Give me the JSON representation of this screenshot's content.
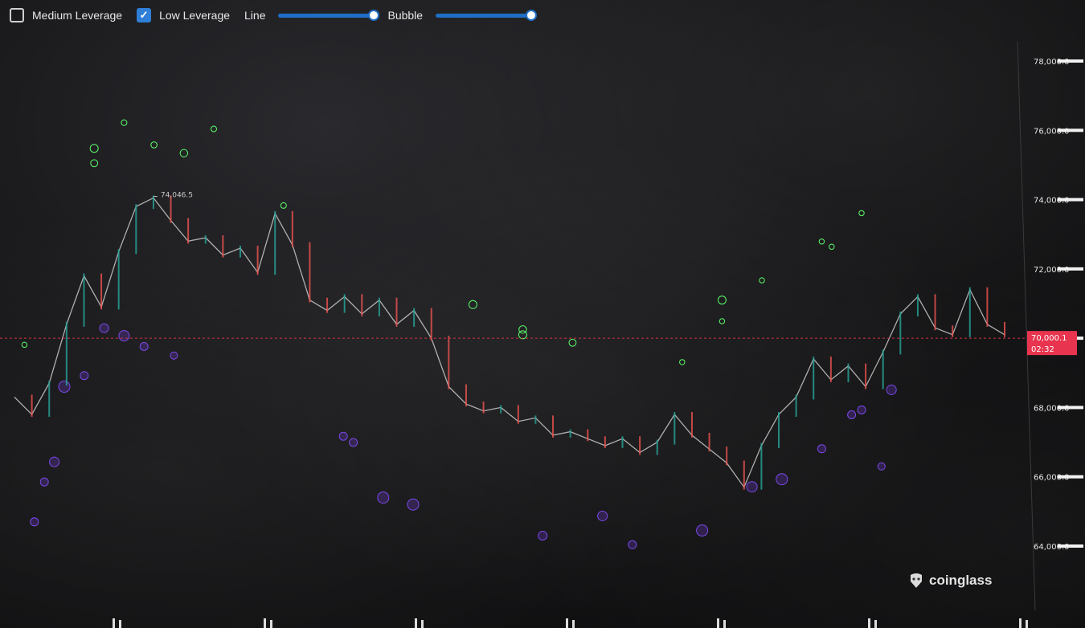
{
  "toolbar": {
    "medium_leverage_label": "Medium Leverage",
    "medium_leverage_checked": false,
    "low_leverage_label": "Low Leverage",
    "low_leverage_checked": true,
    "line_label": "Line",
    "line_value": 1.0,
    "bubble_label": "Bubble",
    "bubble_value": 1.0
  },
  "watermark": {
    "text": "coinglass",
    "icon": "coinglass-logo-icon"
  },
  "colors": {
    "long_liq": "#3ddc4a",
    "short_liq": "#8a3ff0",
    "price_line": "#d43040",
    "price_tag": "#e8344e",
    "candle_up": "#26a69a",
    "candle_down": "#ef5350"
  },
  "chart_data": {
    "type": "line",
    "title": "",
    "ylim": [
      63500,
      78500
    ],
    "y_ticks": [
      "64,000.0",
      "66,000.0",
      "68,000.0",
      "70,000.0",
      "72,000.0",
      "74,000.0",
      "76,000.0",
      "78,000.0"
    ],
    "y_tick_values": [
      64000,
      66000,
      68000,
      70000,
      72000,
      74000,
      76000,
      78000
    ],
    "current_price": 70000.1,
    "current_price_label": "70,000.1",
    "countdown": "02:32",
    "high_annotation": {
      "value": 74046.5,
      "label": "74,046.5"
    },
    "price_series": [
      68300,
      67800,
      68700,
      70400,
      71800,
      70900,
      72500,
      73800,
      74050,
      73400,
      72800,
      72900,
      72400,
      72600,
      71900,
      73600,
      72700,
      71100,
      70800,
      71200,
      70700,
      71100,
      70400,
      70800,
      70000,
      68600,
      68100,
      67900,
      68000,
      67600,
      67700,
      67200,
      67300,
      67100,
      66900,
      67100,
      66700,
      67000,
      67800,
      67200,
      66800,
      66400,
      65700,
      66900,
      67800,
      68300,
      69400,
      68800,
      69200,
      68600,
      69600,
      70700,
      71200,
      70300,
      70100,
      71400,
      70400,
      70100
    ],
    "long_levels": [
      {
        "price": 76220,
        "start": 0.11,
        "weight": 0.5
      },
      {
        "price": 76040,
        "start": 0.2,
        "weight": 0.5
      },
      {
        "price": 75580,
        "start": 0.14,
        "weight": 0.6
      },
      {
        "price": 75480,
        "start": 0.08,
        "weight": 1.0
      },
      {
        "price": 75340,
        "start": 0.17,
        "weight": 0.9
      },
      {
        "price": 75050,
        "start": 0.08,
        "weight": 0.8
      },
      {
        "price": 73830,
        "start": 0.27,
        "weight": 0.5
      },
      {
        "price": 73610,
        "start": 0.85,
        "weight": 0.4
      },
      {
        "price": 72790,
        "start": 0.81,
        "weight": 0.4
      },
      {
        "price": 72640,
        "start": 0.82,
        "weight": 0.4
      },
      {
        "price": 71670,
        "start": 0.75,
        "weight": 0.4
      },
      {
        "price": 71100,
        "start": 0.71,
        "weight": 1.0
      },
      {
        "price": 70970,
        "start": 0.46,
        "weight": 1.0
      },
      {
        "price": 70490,
        "start": 0.71,
        "weight": 0.4
      },
      {
        "price": 70250,
        "start": 0.51,
        "weight": 0.9
      },
      {
        "price": 70100,
        "start": 0.51,
        "weight": 1.0
      },
      {
        "price": 69870,
        "start": 0.56,
        "weight": 0.8
      },
      {
        "price": 69810,
        "start": 0.01,
        "weight": 0.4
      },
      {
        "price": 69310,
        "start": 0.67,
        "weight": 0.4
      }
    ],
    "short_levels": [
      {
        "price": 70290,
        "start": 0.09,
        "weight": 0.7
      },
      {
        "price": 70070,
        "start": 0.11,
        "weight": 0.9
      },
      {
        "price": 69760,
        "start": 0.13,
        "weight": 0.6
      },
      {
        "price": 69500,
        "start": 0.16,
        "weight": 0.5
      },
      {
        "price": 68920,
        "start": 0.07,
        "weight": 0.6
      },
      {
        "price": 68600,
        "start": 0.05,
        "weight": 1.0
      },
      {
        "price": 68510,
        "start": 0.88,
        "weight": 0.8
      },
      {
        "price": 67930,
        "start": 0.85,
        "weight": 0.6
      },
      {
        "price": 67790,
        "start": 0.84,
        "weight": 0.6
      },
      {
        "price": 67170,
        "start": 0.33,
        "weight": 0.6
      },
      {
        "price": 66990,
        "start": 0.34,
        "weight": 0.6
      },
      {
        "price": 66810,
        "start": 0.81,
        "weight": 0.6
      },
      {
        "price": 66430,
        "start": 0.04,
        "weight": 0.8
      },
      {
        "price": 66300,
        "start": 0.87,
        "weight": 0.5
      },
      {
        "price": 65930,
        "start": 0.77,
        "weight": 1.0
      },
      {
        "price": 65850,
        "start": 0.03,
        "weight": 0.6
      },
      {
        "price": 65710,
        "start": 0.74,
        "weight": 0.9
      },
      {
        "price": 65400,
        "start": 0.37,
        "weight": 1.0
      },
      {
        "price": 65200,
        "start": 0.4,
        "weight": 1.0
      },
      {
        "price": 64870,
        "start": 0.59,
        "weight": 0.8
      },
      {
        "price": 64700,
        "start": 0.02,
        "weight": 0.6
      },
      {
        "price": 64450,
        "start": 0.69,
        "weight": 1.0
      },
      {
        "price": 64300,
        "start": 0.53,
        "weight": 0.7
      },
      {
        "price": 64040,
        "start": 0.62,
        "weight": 0.6
      }
    ]
  }
}
